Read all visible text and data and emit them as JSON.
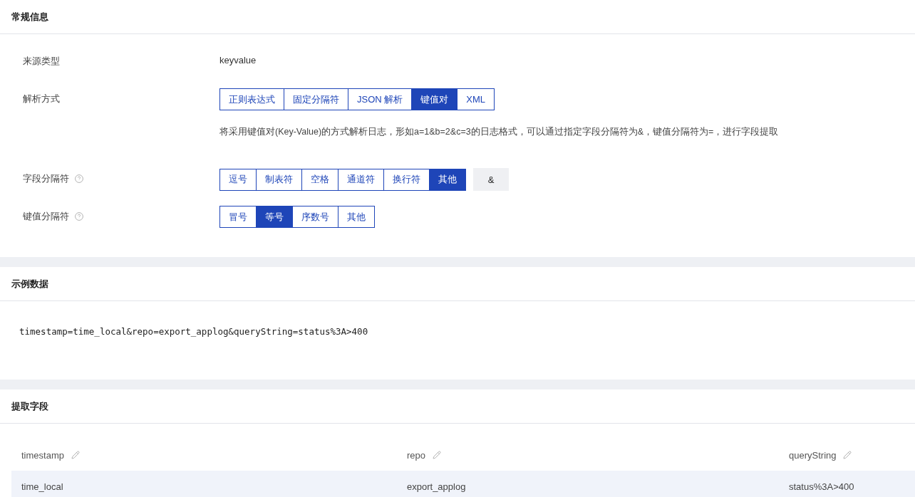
{
  "general": {
    "title": "常规信息",
    "rows": [
      {
        "kind": "text",
        "label": "来源类型",
        "value": "keyvalue"
      },
      {
        "kind": "segmented",
        "label": "解析方式",
        "help": false,
        "options": [
          {
            "label": "正则表达式",
            "selected": false
          },
          {
            "label": "固定分隔符",
            "selected": false
          },
          {
            "label": "JSON 解析",
            "selected": false
          },
          {
            "label": "键值对",
            "selected": true
          },
          {
            "label": "XML",
            "selected": false
          }
        ],
        "description": "将采用键值对(Key-Value)的方式解析日志，形如a=1&b=2&c=3的日志格式，可以通过指定字段分隔符为&，键值分隔符为=，进行字段提取"
      },
      {
        "kind": "segmented",
        "label": "字段分隔符",
        "help": true,
        "options": [
          {
            "label": "逗号",
            "selected": false
          },
          {
            "label": "制表符",
            "selected": false
          },
          {
            "label": "空格",
            "selected": false
          },
          {
            "label": "通道符",
            "selected": false
          },
          {
            "label": "换行符",
            "selected": false
          },
          {
            "label": "其他",
            "selected": true
          }
        ],
        "custom_value": "&"
      },
      {
        "kind": "segmented",
        "label": "键值分隔符",
        "help": true,
        "options": [
          {
            "label": "冒号",
            "selected": false
          },
          {
            "label": "等号",
            "selected": true
          },
          {
            "label": "序数号",
            "selected": false
          },
          {
            "label": "其他",
            "selected": false
          }
        ]
      }
    ]
  },
  "sample": {
    "title": "示例数据",
    "text": "timestamp=time_local&repo=export_applog&queryString=status%3A>400"
  },
  "fields": {
    "title": "提取字段",
    "columns": [
      "timestamp",
      "repo",
      "queryString"
    ],
    "rows": [
      [
        "time_local",
        "export_applog",
        "status%3A>400"
      ]
    ]
  }
}
